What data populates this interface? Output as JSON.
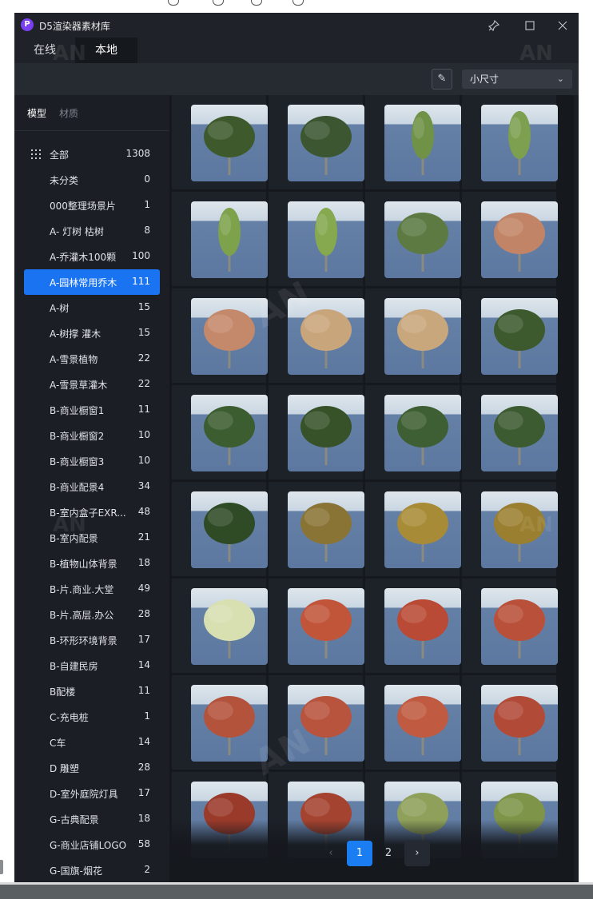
{
  "window": {
    "title": "D5渲染器素材库"
  },
  "tabs": [
    {
      "label": "在线"
    },
    {
      "label": "本地"
    }
  ],
  "toolbar": {
    "size_value": "小尺寸"
  },
  "sidebar": {
    "tabs": [
      {
        "label": "模型"
      },
      {
        "label": "材质"
      }
    ],
    "categories": [
      {
        "label": "全部",
        "count": "1308"
      },
      {
        "label": "未分类",
        "count": "0"
      },
      {
        "label": "000整理场景片",
        "count": "1"
      },
      {
        "label": "A- 灯树 枯树",
        "count": "8"
      },
      {
        "label": "A-乔灌木100颗",
        "count": "100"
      },
      {
        "label": "A-园林常用乔木",
        "count": "111"
      },
      {
        "label": "A-树",
        "count": "15"
      },
      {
        "label": "A-树撑 灌木",
        "count": "15"
      },
      {
        "label": "A-雪景植物",
        "count": "22"
      },
      {
        "label": "A-雪景草灌木",
        "count": "22"
      },
      {
        "label": "B-商业橱窗1",
        "count": "11"
      },
      {
        "label": "B-商业橱窗2",
        "count": "10"
      },
      {
        "label": "B-商业橱窗3",
        "count": "10"
      },
      {
        "label": "B-商业配景4",
        "count": "34"
      },
      {
        "label": "B-室内盒子EXR...",
        "count": "48"
      },
      {
        "label": "B-室内配景",
        "count": "21"
      },
      {
        "label": "B-植物山体背景",
        "count": "18"
      },
      {
        "label": "B-片.商业.大堂",
        "count": "49"
      },
      {
        "label": "B-片.高层.办公",
        "count": "28"
      },
      {
        "label": "B-环形环境背景",
        "count": "17"
      },
      {
        "label": "B-自建民房",
        "count": "14"
      },
      {
        "label": "B配楼",
        "count": "11"
      },
      {
        "label": "C-充电桩",
        "count": "1"
      },
      {
        "label": "C车",
        "count": "14"
      },
      {
        "label": "D 雕塑",
        "count": "28"
      },
      {
        "label": "D-室外庭院灯具",
        "count": "17"
      },
      {
        "label": "G-古典配景",
        "count": "18"
      },
      {
        "label": "G-商业店铺LOGO",
        "count": "58"
      },
      {
        "label": "G-国旗-烟花",
        "count": "2"
      }
    ]
  },
  "pagination": {
    "prev": "‹",
    "pages": [
      "1",
      "2"
    ],
    "current": "1",
    "next": "›"
  },
  "thumbnails": [
    "#3e5a2c",
    "#3b5630",
    "#6f9247",
    "#7da050",
    "#7ea24c",
    "#86a84f",
    "#5c7a42",
    "#c28466",
    "#c4886a",
    "#c9a57c",
    "#c9a77c",
    "#3d5a2e",
    "#3c5d30",
    "#375229",
    "#3e5f33",
    "#3c5b30",
    "#2f4b26",
    "#8a7435",
    "#a88b36",
    "#9b7f30",
    "#d8dfb0",
    "#c1553a",
    "#b94a35",
    "#b9503a",
    "#b4533c",
    "#b8543d",
    "#c05a40",
    "#b24a38",
    "#9a3a2a",
    "#a4432f",
    "#8ea05a",
    "#7e9448"
  ],
  "icons": {
    "logo": "d5-logo-icon",
    "pin": "pin-icon",
    "maximize": "maximize-icon",
    "close": "close-icon",
    "edit": "pencil-icon",
    "dropdown": "chevron-down-icon",
    "all": "grid-icon"
  }
}
